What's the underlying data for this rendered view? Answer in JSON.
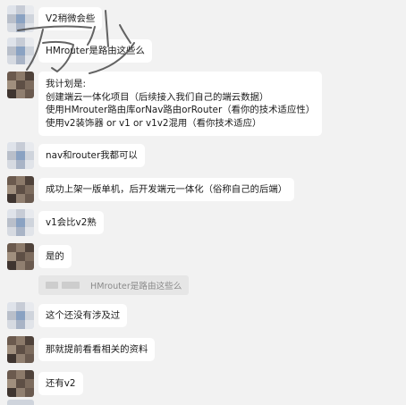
{
  "messages": [
    {
      "text": "V2稍微会些"
    },
    {
      "text": "HMrouter是路由这些么"
    },
    {
      "lines": [
        "我计划是:",
        "创建端云一体化项目（后续接入我们自己的端云数据）",
        "使用HMrouter路由库orNav路由orRouter（看你的技术适应性）",
        "使用v2装饰器 or v1 or v1v2混用（看你技术适应）"
      ]
    },
    {
      "text": "nav和router我都可以"
    },
    {
      "text": "成功上架一版单机，后开发端元一体化（俗称自己的后端）"
    },
    {
      "text": "v1会比v2熟"
    },
    {
      "text": "是的"
    },
    {
      "text": "这个还没有涉及过"
    },
    {
      "text": "那就提前看看相关的资料"
    },
    {
      "text": "还有v2"
    }
  ],
  "quote": {
    "text": "HMrouter是路由这些么"
  },
  "overlay": {
    "handwriting": "万少"
  }
}
